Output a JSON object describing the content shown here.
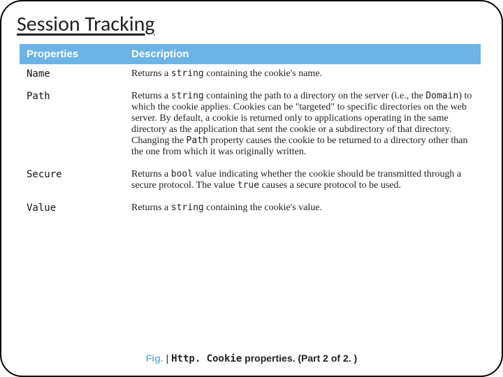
{
  "title": "Session Tracking",
  "table": {
    "headers": {
      "properties": "Properties",
      "description": "Description"
    },
    "rows": [
      {
        "name": "Name",
        "desc_pre": "Returns a ",
        "code1": "string",
        "desc_post": " containing the cookie's name."
      },
      {
        "name": "Path",
        "desc_pre": "Returns a ",
        "code1": "string",
        "desc_mid1": " containing the path to a directory on the server (i.e., the ",
        "code2": "Domain",
        "desc_mid2": ") to which the cookie applies. Cookies can be \"targeted\" to specific directories on the web server. By default, a cookie is returned only to applications operating in the same directory as the application that sent the cookie or a subdirectory of that directory. Changing the ",
        "code3": "Path",
        "desc_post": " property causes the cookie to be returned to a directory other than the one from which it was originally written."
      },
      {
        "name": "Secure",
        "desc_pre": "Returns a ",
        "code1": "bool",
        "desc_mid1": " value indicating whether the cookie should be transmitted through a secure protocol. The value ",
        "code2": "true",
        "desc_post": " causes a secure protocol to be used."
      },
      {
        "name": "Value",
        "desc_pre": "Returns a ",
        "code1": "string",
        "desc_post": " containing the cookie's value."
      }
    ]
  },
  "caption": {
    "fig": "Fig.",
    "sep": " | ",
    "code": "Http. Cookie",
    "rest": " properties. (Part 2 of 2. )"
  }
}
